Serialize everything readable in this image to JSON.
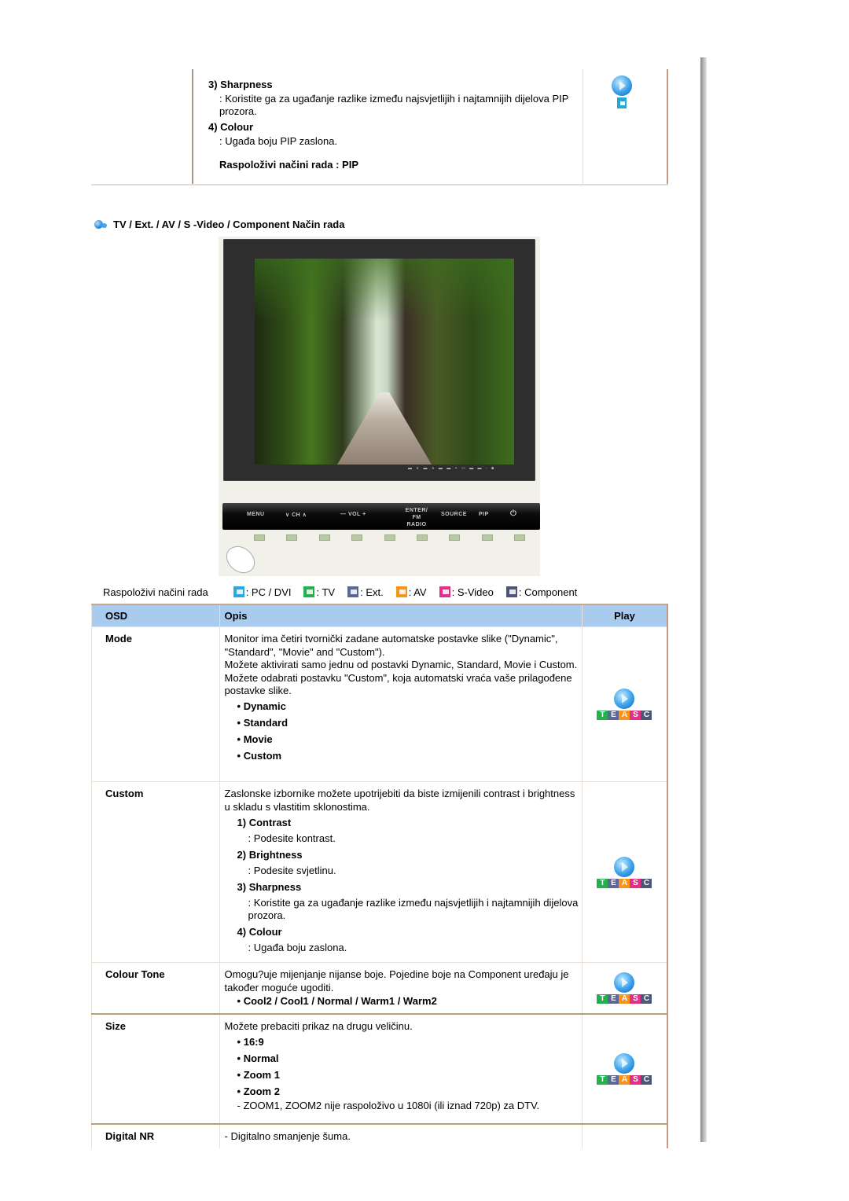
{
  "pip_section": {
    "items": [
      {
        "heading": "3) Sharpness",
        "text": ": Koristite ga za ugađanje razlike između najsvjetlijih i najtamnijih dijelova PIP prozora."
      },
      {
        "heading": "4) Colour",
        "text": ": Ugađa boju PIP zaslona."
      }
    ],
    "available_modes": "Raspoloživi načini rada : PIP",
    "play_icon": "play-orb-icon",
    "mode_icon": "pc-mode-icon"
  },
  "section_title": "TV / Ext. / AV / S -Video / Component Način rada",
  "monitor_image": {
    "buttons": [
      "MENU",
      "∨ CH ∧",
      "— VOL +",
      "ENTER/ FM RADIO",
      "SOURCE",
      "PIP",
      "⏻"
    ]
  },
  "modes_legend": {
    "label": "Raspoloživi načini rada",
    "items": [
      {
        "icon": "pc-icon",
        "letter": "P",
        "label": ": PC / DVI",
        "color": "#29a9e0"
      },
      {
        "icon": "tv-icon",
        "letter": "T",
        "label": ": TV",
        "color": "#22b14c"
      },
      {
        "icon": "ext-icon",
        "letter": "E",
        "label": ": Ext.",
        "color": "#5e6699"
      },
      {
        "icon": "av-icon",
        "letter": "A",
        "label": ": AV",
        "color": "#f7941d"
      },
      {
        "icon": "svideo-icon",
        "letter": "S",
        "label": ": S-Video",
        "color": "#e2308a"
      },
      {
        "icon": "component-icon",
        "letter": "C",
        "label": ": Component",
        "color": "#4c5677"
      }
    ]
  },
  "table": {
    "headers": {
      "osd": "OSD",
      "opis": "Opis",
      "play": "Play"
    },
    "header_color": "#a9cbee",
    "rows": [
      {
        "osd": "Mode",
        "text": [
          "Monitor ima četiri tvornički zadane automatske postavke slike (\"Dynamic\", \"Standard\", \"Movie\" and \"Custom\").",
          "Možete aktivirati samo jednu od postavki Dynamic, Standard, Movie i Custom. Možete odabrati postavku \"Custom\", koja automatski vraća vaše prilagođene postavke slike."
        ],
        "options": [
          "• Dynamic",
          "• Standard",
          "• Movie",
          "• Custom"
        ]
      },
      {
        "osd": "Custom",
        "text": "Zaslonske izbornike možete upotrijebiti da biste izmijenili contrast i brightness u skladu s vlastitim sklonostima.",
        "subitems": [
          {
            "heading": "1) Contrast",
            "text": ": Podesite kontrast."
          },
          {
            "heading": "2) Brightness",
            "text": ": Podesite svjetlinu."
          },
          {
            "heading": "3) Sharpness",
            "text": ": Koristite ga za ugađanje razlike između najsvjetlijih i najtamnijih dijelova prozora."
          },
          {
            "heading": "4) Colour",
            "text": ": Ugađa boju zaslona."
          }
        ]
      },
      {
        "osd": "Colour Tone",
        "text": "Omogu?uje mijenjanje nijanse boje. Pojedine boje na Component uređaju je također moguće ugoditi.",
        "options": [
          "• Cool2 / Cool1 / Normal / Warm1 / Warm2"
        ]
      },
      {
        "osd": "Size",
        "text": "Možete prebaciti prikaz na drugu veličinu.",
        "options": [
          "• 16:9",
          "• Normal",
          "• Zoom 1",
          "• Zoom 2"
        ],
        "note": "- ZOOM1, ZOOM2 nije raspoloživo u 1080i (ili iznad 720p) za DTV."
      },
      {
        "osd": "Digital NR",
        "text": "- Digitalno smanjenje šuma."
      }
    ],
    "teasc_letters": [
      "T",
      "E",
      "A",
      "S",
      "C"
    ],
    "teasc_colors": [
      "#22b14c",
      "#5e6699",
      "#f7941d",
      "#e2308a",
      "#4c5677"
    ]
  }
}
